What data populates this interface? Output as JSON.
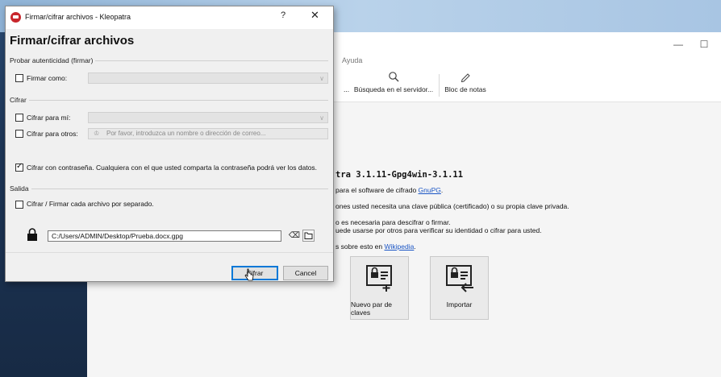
{
  "main_window": {
    "menu": [
      "Ayuda"
    ],
    "toolbar": {
      "partial_label": "...",
      "search_server_label": "Búsqueda en el servidor...",
      "notepad_label": "Bloc de notas"
    },
    "content": {
      "heading": "tra 3.1.11-Gpg4win-3.1.11",
      "line1_pre": "para el software de cifrado ",
      "line1_link": "GnuPG",
      "line1_post": ".",
      "line2": "ones usted necesita una clave pública (certificado) o su propia clave privada.",
      "line3": "o es necesaria para descifrar o firmar.",
      "line4": "uede usarse por otros para verificar su identidad o cifrar para usted.",
      "line5_pre": "s sobre esto en ",
      "line5_link": "Wikipedia",
      "line5_post": ".",
      "new_keypair_label": "Nuevo par de claves",
      "import_label": "Importar"
    }
  },
  "dialog": {
    "title": "Firmar/cifrar archivos - Kleopatra",
    "help": "?",
    "close": "✕",
    "heading": "Firmar/cifrar archivos",
    "sign_group": "Probar autenticidad (firmar)",
    "sign_as_label": "Firmar como:",
    "encrypt_group": "Cifrar",
    "encrypt_me_label": "Cifrar para mí:",
    "encrypt_others_label": "Cifrar para otros:",
    "encrypt_others_placeholder": "Por favor, introduzca un nombre o dirección de correo...",
    "password_label": "Cifrar con contraseña. Cualquiera con el que usted comparta la contraseña podrá ver los datos.",
    "output_group": "Salida",
    "separate_label": "Cifrar / Firmar cada archivo por separado.",
    "output_path": "C:/Users/ADMIN/Desktop/Prueba.docx.gpg",
    "encrypt_button": "Cifrar",
    "cancel_button": "Cancel",
    "checks": {
      "sign_as": false,
      "encrypt_me": false,
      "encrypt_others": false,
      "password": true,
      "separate": false
    }
  }
}
